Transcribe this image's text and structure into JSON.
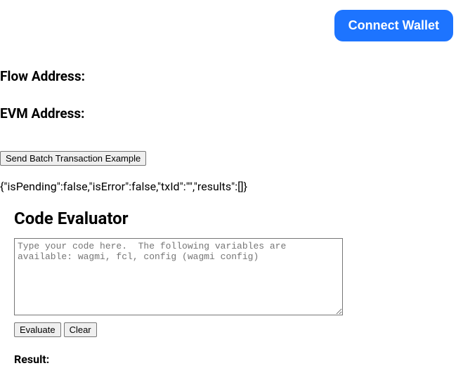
{
  "header": {
    "connect_wallet_label": "Connect Wallet"
  },
  "addresses": {
    "flow_label": "Flow Address:",
    "evm_label": "EVM Address:"
  },
  "batch": {
    "button_label": "Send Batch Transaction Example",
    "status_json": "{\"isPending\":false,\"isError\":false,\"txId\":\"\",\"results\":[]}"
  },
  "evaluator": {
    "heading": "Code Evaluator",
    "placeholder": "Type your code here.  The following variables are available: wagmi, fcl, config (wagmi config)",
    "evaluate_label": "Evaluate",
    "clear_label": "Clear",
    "result_label": "Result:"
  }
}
